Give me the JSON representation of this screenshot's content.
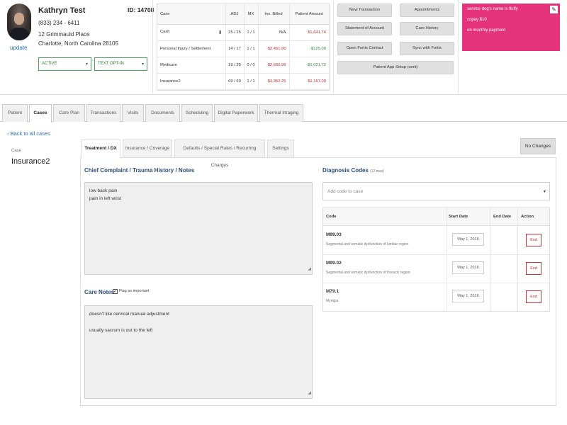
{
  "patient": {
    "name": "Kathryn Test",
    "id_label": "ID: 14708",
    "phone": "(833) 234 - 6411",
    "address_line1": "12 Grimmauld Place",
    "address_line2": "Charlotte, North Carolina 28105",
    "update_label": "update",
    "status_value": "ACTIVE",
    "text_value": "TEXT OPT-IN"
  },
  "case_table": {
    "headers": [
      "Case",
      "ADJ",
      "MX",
      "Ins. Billed",
      "Patient Amount"
    ],
    "rows": [
      {
        "case": "Cash",
        "adj": "25 / 25",
        "mx": "1 / 1",
        "billed": "N/A",
        "amount": "$1,641.74"
      },
      {
        "case": "Personal Injury / Settlement",
        "adj": "14 / 17",
        "mx": "1 / 1",
        "billed": "$2,451.00",
        "amount": "-$125.00"
      },
      {
        "case": "Medicare",
        "adj": "19 / 35",
        "mx": "0 / 0",
        "billed": "$2,660.99",
        "amount": "-$1,021.72"
      },
      {
        "case": "Insurance2",
        "adj": "69 / 69",
        "mx": "1 / 1",
        "billed": "$4,352.25",
        "amount": "$1,167.00"
      }
    ]
  },
  "actions": {
    "new_transaction": "New Transaction",
    "appointments": "Appointments",
    "statement": "Statement of Account",
    "care_history": "Care History",
    "open_fortis": "Open Fortis Contact",
    "sync_fortis": "Sync with Fortis",
    "app_setup": "Patient App Setup (sent)"
  },
  "alert": {
    "line1": "service dog's name is fluffy",
    "line2": "copay $10",
    "line3": "on monthly payment"
  },
  "tabs": [
    "Patient",
    "Cases",
    "Care Plan",
    "Transactions",
    "Visits",
    "Documents",
    "Scheduling",
    "Digital Paperwork",
    "Thermal Imaging"
  ],
  "case": {
    "back_label": "Back to all cases",
    "label": "Case",
    "name": "Insurance2"
  },
  "subtabs": [
    "Treatment / DX",
    "Insurance / Coverage",
    "Defaults / Special Rates / Recurring Charges",
    "Settings"
  ],
  "no_changes_label": "No Changes",
  "complaint": {
    "title": "Chief Complaint / Trauma History / Notes",
    "line1": "low back pain",
    "line2": "pain in left wrist"
  },
  "care_notes": {
    "title": "Care Notes",
    "flag_label": "Flag as important",
    "line1": "doesn't like cervical manual adjustment",
    "line2": "usually sacrum is out to the left"
  },
  "dx": {
    "title": "Diagnosis Codes",
    "subtitle": "(12 max)",
    "placeholder": "Add code to case",
    "headers": {
      "code": "Code",
      "start": "Start Date",
      "end": "End Date",
      "action": "Action"
    },
    "rows": [
      {
        "code": "M99.03",
        "desc": "Segmental and somatic dysfunction of lumbar region",
        "start": "May 1, 2018",
        "action": "End"
      },
      {
        "code": "M99.02",
        "desc": "Segmental and somatic dysfunction of thoracic region",
        "start": "May 1, 2018",
        "action": "End"
      },
      {
        "code": "M79.1",
        "desc": "Myalgia",
        "start": "May 1, 2018",
        "action": "End"
      }
    ]
  },
  "colors": {
    "alert_bg": "#e4337a",
    "link": "#2a6db2",
    "negative": "#c0282d",
    "positive": "#2e8b3e"
  }
}
